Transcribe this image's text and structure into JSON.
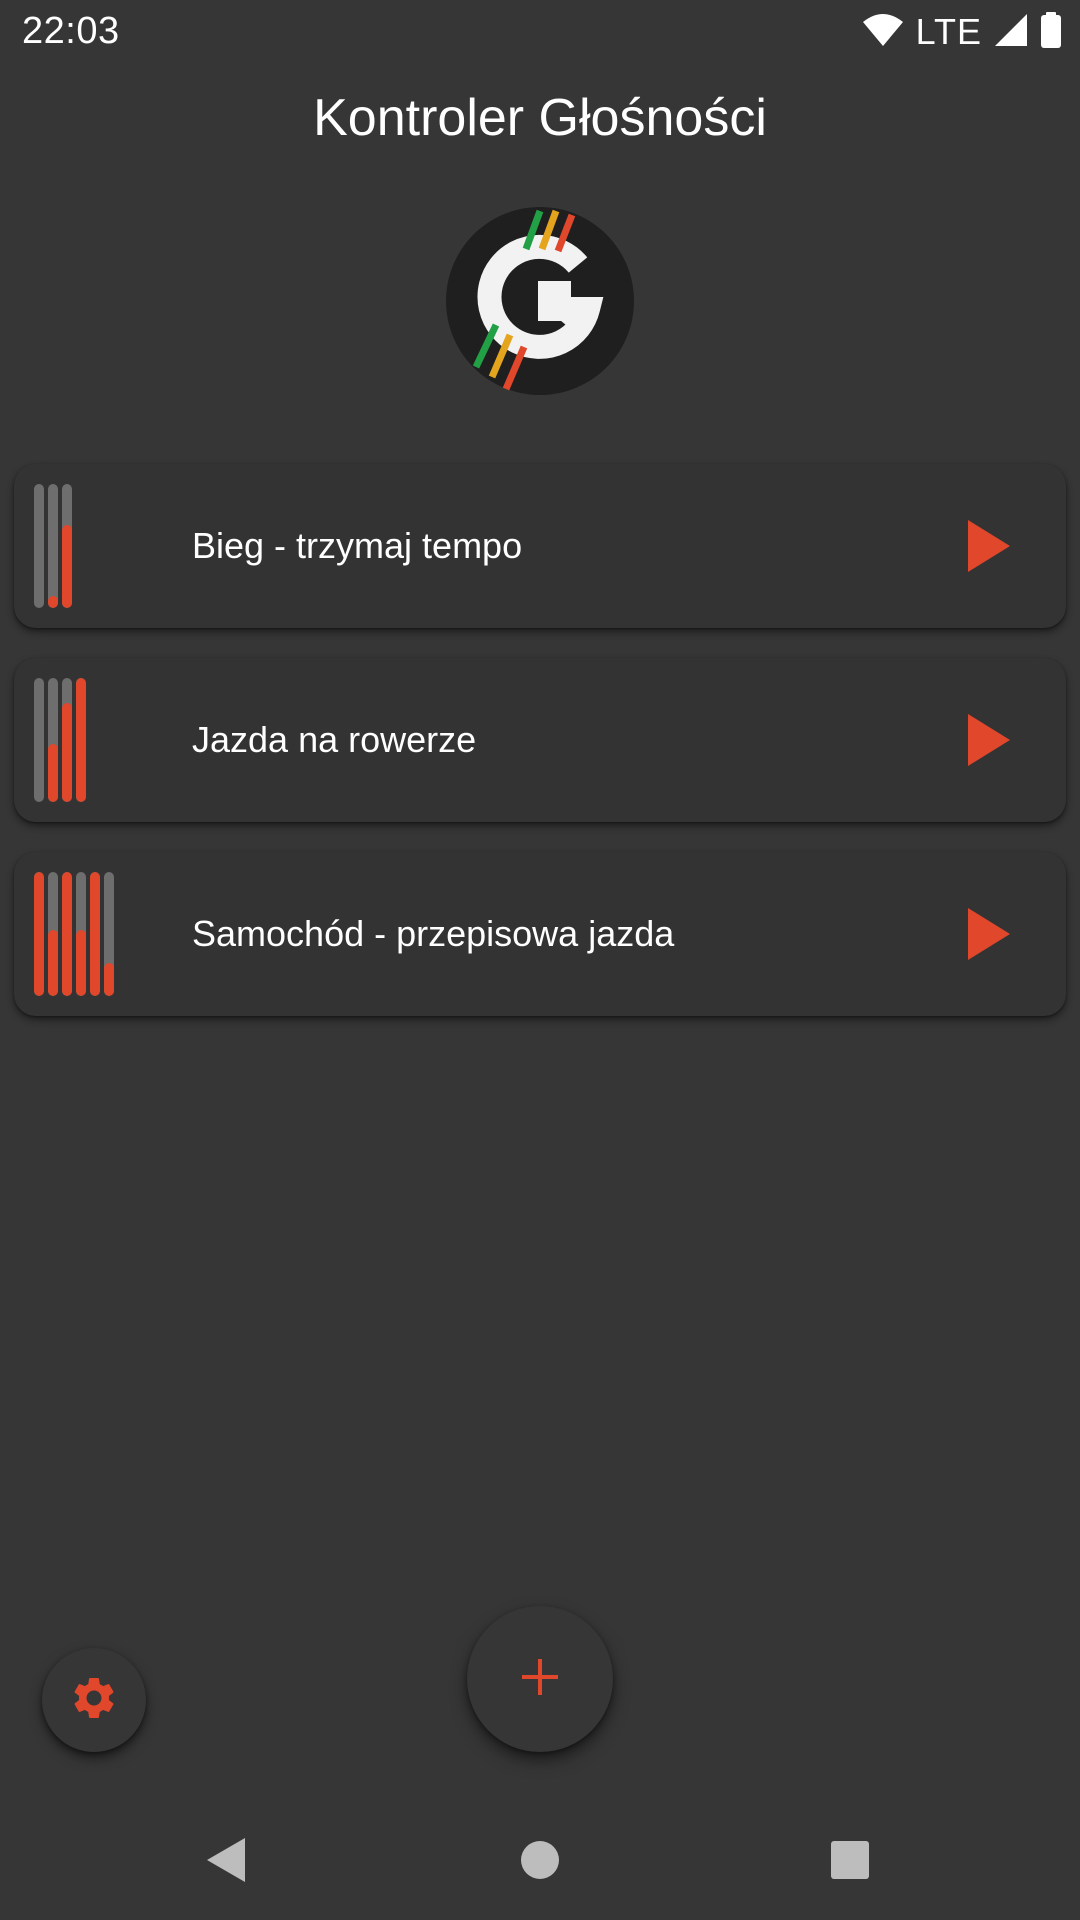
{
  "status_bar": {
    "time": "22:03",
    "network": "LTE",
    "icons": [
      "wifi-icon",
      "signal-icon",
      "battery-icon"
    ]
  },
  "app": {
    "title": "Kontroler Głośności",
    "logo": "app-logo-g-icon"
  },
  "profiles": [
    {
      "label": "Bieg - trzymaj tempo",
      "action_icon": "play-icon",
      "volume_levels": [
        0.0,
        0.1,
        0.67
      ]
    },
    {
      "label": "Jazda na rowerze",
      "action_icon": "play-icon",
      "volume_levels": [
        0.0,
        0.47,
        0.8,
        1.0
      ]
    },
    {
      "label": "Samochód - przepisowa jazda",
      "action_icon": "play-icon",
      "volume_levels": [
        1.0,
        0.53,
        1.0,
        0.53,
        1.0,
        0.27
      ]
    }
  ],
  "actions": {
    "settings_icon": "gear-icon",
    "add_icon": "plus-icon"
  },
  "navigation": {
    "back_icon": "back-triangle-icon",
    "home_icon": "home-circle-icon",
    "recents_icon": "recents-square-icon"
  },
  "colors": {
    "background": "#363636",
    "card": "#333333",
    "accent": "#e0472b",
    "bar_track": "#6e6e6e",
    "text": "#ffffff"
  }
}
